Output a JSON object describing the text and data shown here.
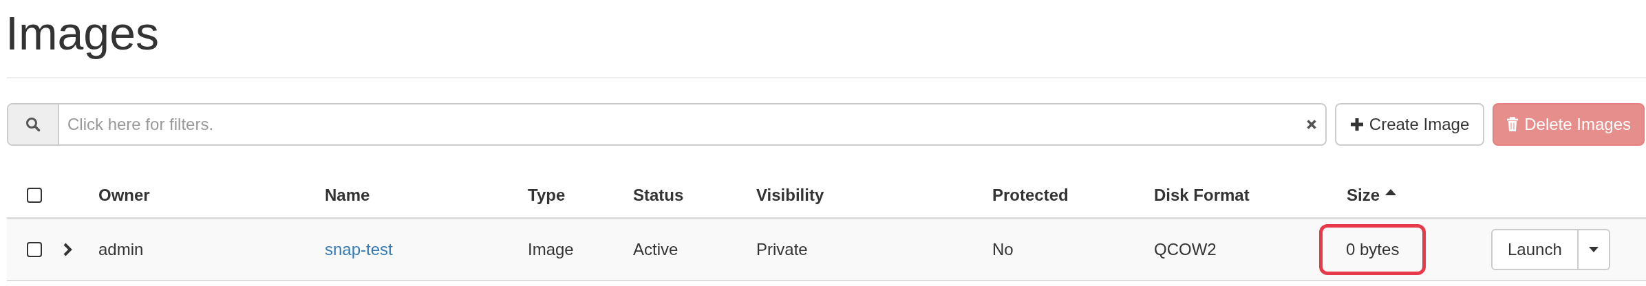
{
  "page": {
    "title": "Images"
  },
  "filter": {
    "placeholder": "Click here for filters."
  },
  "actions": [
    {
      "kind": "create",
      "label": "Create Image",
      "disabled": false
    },
    {
      "kind": "delete",
      "label": "Delete Images",
      "disabled": true
    }
  ],
  "table": {
    "select_all": {
      "checked": false
    },
    "columns": [
      {
        "label": "Owner",
        "kind": "text",
        "sorted": false
      },
      {
        "label": "Name",
        "kind": "link",
        "sorted": false
      },
      {
        "label": "Type",
        "kind": "text",
        "sorted": false
      },
      {
        "label": "Status",
        "kind": "text",
        "sorted": false
      },
      {
        "label": "Visibility",
        "kind": "text",
        "sorted": false
      },
      {
        "label": "Protected",
        "kind": "text",
        "sorted": false
      },
      {
        "label": "Disk Format",
        "kind": "text",
        "sorted": false
      },
      {
        "label": "Size",
        "kind": "text",
        "sorted": true
      }
    ],
    "rows": [
      {
        "checked": false,
        "expanded": false,
        "action": "Launch",
        "cells": [
          {
            "text": "admin",
            "highlighted": false
          },
          {
            "text": "snap-test",
            "highlighted": false
          },
          {
            "text": "Image",
            "highlighted": false
          },
          {
            "text": "Active",
            "highlighted": false
          },
          {
            "text": "Private",
            "highlighted": false
          },
          {
            "text": "No",
            "highlighted": false
          },
          {
            "text": "QCOW2",
            "highlighted": false
          },
          {
            "text": "0 bytes",
            "highlighted": true
          }
        ]
      }
    ]
  }
}
